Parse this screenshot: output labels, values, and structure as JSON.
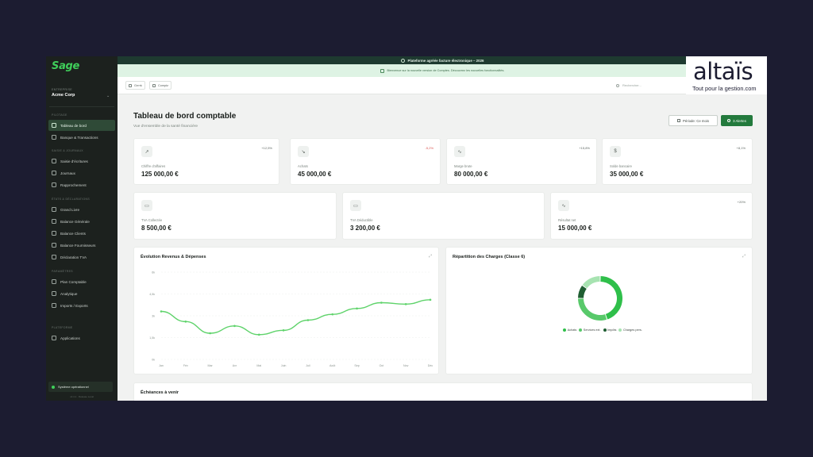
{
  "sidebar": {
    "logo": "Sage",
    "entreprise_caption": "ENTREPRISE",
    "entreprise_name": "Acme Corp",
    "sections": [
      {
        "title": "PILOTAGE",
        "items": [
          "Tableau de bord",
          "Banque & Transactions"
        ]
      },
      {
        "title": "SAISIE & JOURNAUX",
        "items": [
          "Saisie d'écritures",
          "Journaux",
          "Rapprochement"
        ]
      },
      {
        "title": "ÉTATS & DÉCLARATIONS",
        "items": [
          "Grand Livre",
          "Balance Générale",
          "Balance Clients",
          "Balance Fournisseurs",
          "Déclaration TVA"
        ]
      },
      {
        "title": "PARAMÈTRES",
        "items": [
          "Plan Comptable",
          "Analytique",
          "Imports / Exports"
        ]
      },
      {
        "title": "PLATEFORME",
        "items": [
          "Applications"
        ]
      }
    ],
    "active_item": "Tableau de bord",
    "system_status": "Système opérationnel",
    "version": "v2.4.1 · Release Local"
  },
  "banner": {
    "platform": "Plateforme agréée facture électronique – 2026",
    "welcome": "Bienvenue sur la nouvelle version de Comptes. Découvrez les nouvelles fonctionnalités."
  },
  "toolbar": {
    "btn1": "Grrrrk",
    "btn2": "Comptz",
    "search_placeholder": "Rechercher..."
  },
  "header": {
    "title": "Tableau de bord comptable",
    "subtitle": "Vue d'ensemble de la santé financière",
    "period_button": "Période: Ce mois",
    "alerts_button": "3 Alertes"
  },
  "kpis_row1": [
    {
      "label": "Chiffre d'affaires",
      "value": "125 000,00 €",
      "trend": "+12,5%",
      "negative": false,
      "icon": "trend-up"
    },
    {
      "label": "Achats",
      "value": "45 000,00 €",
      "trend": "-5,2%",
      "negative": true,
      "icon": "trend-down"
    },
    {
      "label": "Marge brute",
      "value": "80 000,00 €",
      "trend": "+15,8%",
      "negative": false,
      "icon": "activity"
    },
    {
      "label": "Solde bancaire",
      "value": "35 000,00 €",
      "trend": "+8,1%",
      "negative": false,
      "icon": "dollar"
    }
  ],
  "kpis_row2": [
    {
      "label": "TVA Collectée",
      "value": "8 500,00 €",
      "trend": "",
      "negative": false,
      "icon": "card"
    },
    {
      "label": "TVA Déductible",
      "value": "3 200,00 €",
      "trend": "",
      "negative": false,
      "icon": "card"
    },
    {
      "label": "Résultat net",
      "value": "15 000,00 €",
      "trend": "+20%",
      "negative": false,
      "icon": "activity"
    }
  ],
  "charts": {
    "line_title": "Évolution Revenus & Dépenses",
    "donut_title": "Répartition des Charges (Classe 6)",
    "upcoming_title": "Échéances à venir"
  },
  "chart_data": [
    {
      "type": "line",
      "title": "Évolution Revenus & Dépenses",
      "categories": [
        "Jan",
        "Fév",
        "Mar",
        "Avr",
        "Mai",
        "Juin",
        "Juil",
        "Août",
        "Sep",
        "Oct",
        "Nov",
        "Déc"
      ],
      "series": [
        {
          "values": [
            3300,
            2600,
            1800,
            2300,
            1700,
            2000,
            2700,
            3100,
            3500,
            3900,
            3800,
            4100
          ]
        }
      ],
      "y_tick_labels": [
        "0k",
        "1,5k",
        "3k",
        "4,5k",
        "6k"
      ],
      "ylim": [
        0,
        6000
      ],
      "color": "#5fd36b",
      "grid": true
    },
    {
      "type": "pie",
      "title": "Répartition des Charges (Classe 6)",
      "donut": true,
      "categories": [
        "Achats",
        "Services ext.",
        "Impôts",
        "Charges pers."
      ],
      "values": [
        45,
        30,
        10,
        15
      ],
      "colors": [
        "#2fbf4a",
        "#58c96a",
        "#1f5e32",
        "#a7e3b1"
      ],
      "legend_position": "bottom"
    }
  ],
  "watermark": {
    "brand": "altaïs",
    "tagline": "Tout pour la gestion.com",
    "dot_color": "#e0195a"
  }
}
